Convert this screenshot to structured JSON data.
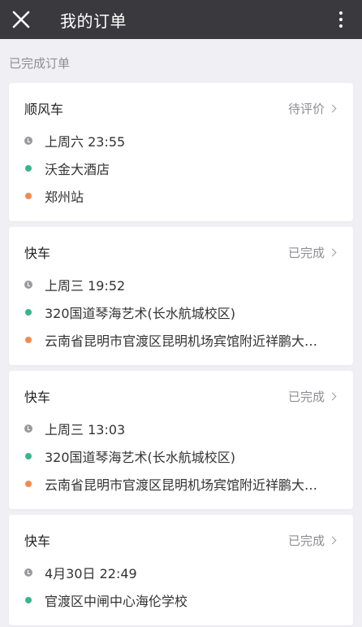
{
  "header": {
    "title": "我的订单"
  },
  "section": {
    "title": "已完成订单"
  },
  "colors": {
    "topbar": "#3a3a3e",
    "start_dot": "#3cb48a",
    "end_dot": "#f08c50"
  },
  "orders": [
    {
      "type": "顺风车",
      "status": "待评价",
      "time": "上周六 23:55",
      "from": "沃金大酒店",
      "to": "郑州站"
    },
    {
      "type": "快车",
      "status": "已完成",
      "time": "上周三 19:52",
      "from": "320国道琴海艺术(长水航城校区)",
      "to": "云南省昆明市官渡区昆明机场宾馆附近祥鹏大…"
    },
    {
      "type": "快车",
      "status": "已完成",
      "time": "上周三 13:03",
      "from": "320国道琴海艺术(长水航城校区)",
      "to": "云南省昆明市官渡区昆明机场宾馆附近祥鹏大…"
    },
    {
      "type": "快车",
      "status": "已完成",
      "time": "4月30日 22:49",
      "from": "官渡区中闸中心海伦学校"
    }
  ]
}
